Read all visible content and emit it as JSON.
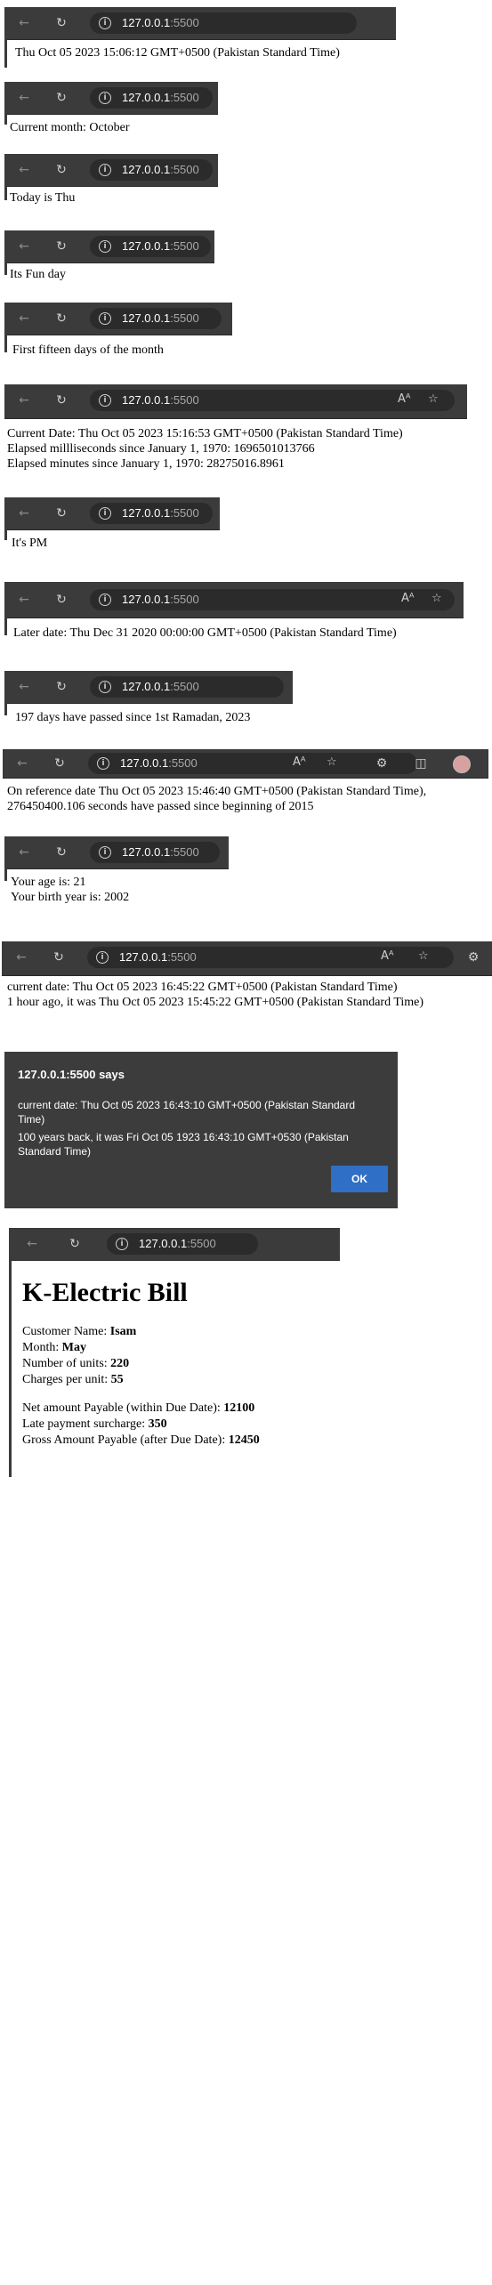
{
  "browser": {
    "host": "127.0.0.1",
    "port": ":5500",
    "icons": {
      "back": "back-arrow-icon",
      "reload": "reload-icon",
      "info": "info-icon",
      "read_aloud": "read-aloud-icon",
      "favorite": "star-icon",
      "extensions": "extensions-icon",
      "split": "split-screen-icon",
      "profile": "avatar"
    }
  },
  "outputs": {
    "s1": {
      "lines": [
        "Thu Oct 05 2023 15:06:12 GMT+0500 (Pakistan Standard Time)"
      ]
    },
    "s2": {
      "lines": [
        "Current month: October"
      ]
    },
    "s3": {
      "lines": [
        "Today is Thu"
      ]
    },
    "s4": {
      "lines": [
        "Its Fun day"
      ]
    },
    "s5": {
      "lines": [
        "First fifteen days of the month"
      ]
    },
    "s6": {
      "lines": [
        "Current Date: Thu Oct 05 2023 15:16:53 GMT+0500 (Pakistan Standard Time)",
        "Elapsed millliseconds since January 1, 1970: 1696501013766",
        "Elapsed minutes since January 1, 1970: 28275016.8961"
      ]
    },
    "s7": {
      "lines": [
        "It's PM"
      ]
    },
    "s8": {
      "lines": [
        "Later date: Thu Dec 31 2020 00:00:00 GMT+0500 (Pakistan Standard Time)"
      ]
    },
    "s9": {
      "lines": [
        "197 days have passed since 1st Ramadan, 2023"
      ]
    },
    "s10": {
      "lines": [
        "On reference date Thu Oct 05 2023 15:46:40 GMT+0500 (Pakistan Standard Time),",
        "276450400.106 seconds have passed since beginning of 2015"
      ]
    },
    "s11": {
      "lines": [
        "Your age is: 21",
        "Your birth year is: 2002"
      ]
    },
    "s12": {
      "lines": [
        "current date: Thu Oct 05 2023 16:45:22 GMT+0500 (Pakistan Standard Time)",
        "1 hour ago, it was Thu Oct 05 2023 15:45:22 GMT+0500 (Pakistan Standard Time)"
      ]
    }
  },
  "dialog": {
    "title": "127.0.0.1:5500 says",
    "message_line1": "current date: Thu Oct 05 2023 16:43:10 GMT+0500 (Pakistan Standard Time)",
    "message_line2": "100 years back, it was Fri Oct 05 1923 16:43:10 GMT+0530 (Pakistan Standard Time)",
    "ok_label": "OK"
  },
  "bill": {
    "title": "K-Electric Bill",
    "customer_label": "Customer Name: ",
    "customer_value": "Isam",
    "month_label": "Month: ",
    "month_value": "May",
    "units_label": "Number of units: ",
    "units_value": "220",
    "charges_label": "Charges per unit: ",
    "charges_value": "55",
    "net_label": "Net amount Payable (within Due Date): ",
    "net_value": "12100",
    "late_label": "Late payment surcharge: ",
    "late_value": "350",
    "gross_label": "Gross Amount Payable (after Due Date): ",
    "gross_value": "12450"
  }
}
